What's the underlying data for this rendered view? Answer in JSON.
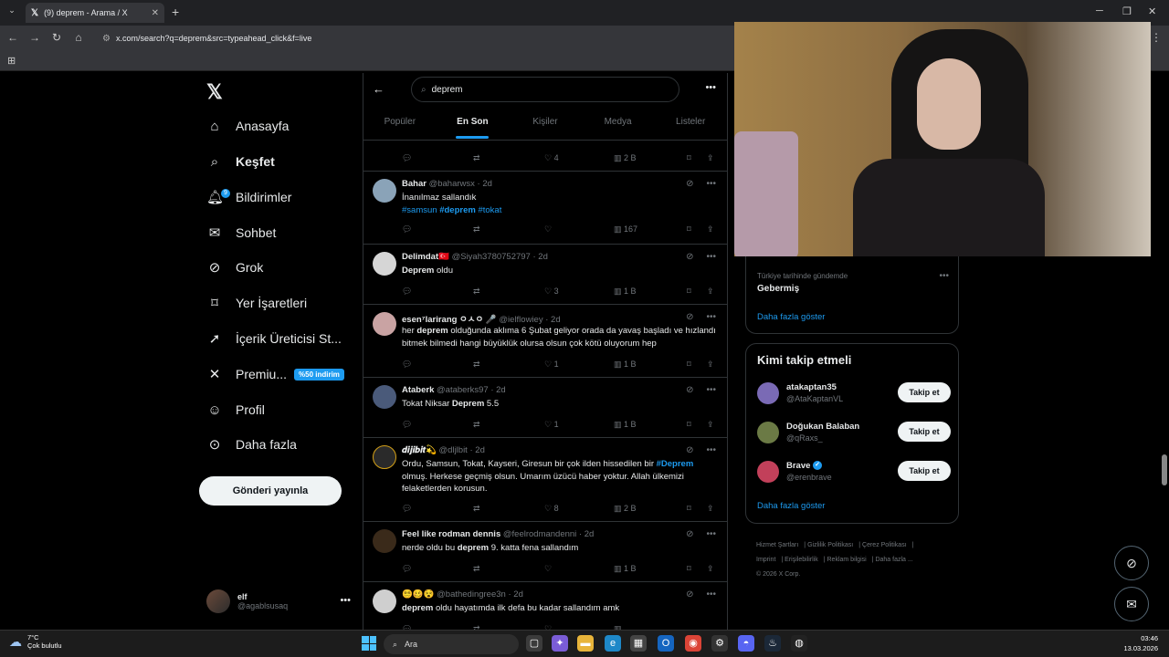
{
  "browser": {
    "tab_title": "(9) deprem - Arama / X",
    "url": "x.com/search?q=deprem&src=typeahead_click&f=live"
  },
  "nav": {
    "items": [
      {
        "label": "Anasayfa",
        "icon": "home-icon"
      },
      {
        "label": "Keşfet",
        "icon": "search-icon"
      },
      {
        "label": "Bildirimler",
        "icon": "bell-icon",
        "badge": "9"
      },
      {
        "label": "Sohbet",
        "icon": "mail-icon"
      },
      {
        "label": "Grok",
        "icon": "grok-icon"
      },
      {
        "label": "Yer İşaretleri",
        "icon": "bookmark-icon"
      },
      {
        "label": "İçerik Üreticisi St...",
        "icon": "rocket-icon"
      },
      {
        "label": "Premiu...",
        "icon": "x-icon"
      },
      {
        "label": "Profil",
        "icon": "person-icon"
      },
      {
        "label": "Daha fazla",
        "icon": "more-circle-icon"
      }
    ],
    "premium_promo": "%50 indirim",
    "post_button": "Gönderi yayınla",
    "account": {
      "name": "elf",
      "handle": "@agablsusaq"
    }
  },
  "search": {
    "query": "deprem",
    "tabs": [
      "Popüler",
      "En Son",
      "Kişiler",
      "Medya",
      "Listeler"
    ],
    "active_tab": "En Son"
  },
  "partial_tweet_stats": {
    "likes": "4",
    "views": "2 B"
  },
  "tweets": [
    {
      "name": "Bahar",
      "handle": "@baharwsx",
      "time": "2d",
      "text": "İnanılmaz sallandık",
      "tags": [
        "#samsun",
        "#deprem",
        "#tokat"
      ],
      "likes": "",
      "views": "167"
    },
    {
      "name": "Delimdat🇹🇷",
      "handle": "@Siyah3780752797",
      "time": "2d",
      "text_bold": "Deprem",
      "text": "oldu",
      "likes": "3",
      "views": "1 B"
    },
    {
      "name": "esen⁷larirang ㅇㅅㅇ 🎤",
      "handle": "@ielflowiey",
      "time": "2d",
      "text_before": "her",
      "text_bold": "deprem",
      "text": "olduğunda aklıma 6 Şubat geliyor orada da yavaş başladı ve hızlandı bitmek bilmedi hangi büyüklük olursa olsun çok kötü oluyorum hep",
      "likes": "1",
      "views": "1 B"
    },
    {
      "name": "Ataberk",
      "handle": "@ataberks97",
      "time": "2d",
      "text_before": "Tokat Niksar",
      "text_bold": "Deprem",
      "text": "5.5",
      "likes": "1",
      "views": "1 B"
    },
    {
      "name": "𝒅𝒊𝒋𝒊𝒃𝒊𝒕💫",
      "handle": "@dljlbit",
      "time": "2d",
      "text_before": "Ordu, Samsun, Tokat, Kayseri, Giresun bir çok ilden hissedilen bir",
      "text_tag": "#Deprem",
      "text": "olmuş. Herkese geçmiş olsun. Umarım üzücü haber yoktur. Allah ülkemizi felaketlerden korusun.",
      "likes": "8",
      "views": "2 B"
    },
    {
      "name": "Feel like rodman dennis",
      "handle": "@feelrodmandenni",
      "time": "2d",
      "text_before": "nerde oldu bu",
      "text_bold": "deprem",
      "text": "9. katta fena sallandım",
      "likes": "",
      "views": "1 B"
    },
    {
      "name": "😵‍💫🥴😵",
      "handle": "@bathedingree3n",
      "time": "2d",
      "text_bold": "deprem",
      "text": "oldu hayatımda ilk defa bu kadar sallandım amk",
      "likes": "",
      "views": ""
    }
  ],
  "trends": {
    "context": "Türkiye tarihinde gündemde",
    "name": "Gebermiş",
    "show_more": "Daha fazla göster"
  },
  "who_to_follow": {
    "title": "Kimi takip etmeli",
    "follow_label": "Takip et",
    "show_more": "Daha fazla göster",
    "users": [
      {
        "name": "atakaptan35",
        "handle": "@AtaKaptanVL",
        "verified": false
      },
      {
        "name": "Doğukan Balaban",
        "handle": "@qRaxs_",
        "verified": false
      },
      {
        "name": "Brave",
        "handle": "@erenbrave",
        "verified": true
      }
    ]
  },
  "footer": {
    "links": [
      "Hizmet Şartları",
      "Gizlilik Politikası",
      "Çerez Politikası",
      "Imprint",
      "Erişilebilirlik",
      "Reklam bilgisi",
      "Daha fazla ..."
    ],
    "copyright": "© 2026 X Corp."
  },
  "taskbar": {
    "weather_temp": "7°C",
    "weather_desc": "Çok bulutlu",
    "search_placeholder": "Ara",
    "time": "03:46",
    "date": "13.03.2026"
  },
  "colors": {
    "accent": "#1d9bf0",
    "background": "#000000",
    "border": "#2f3336",
    "text_secondary": "#71767b"
  }
}
